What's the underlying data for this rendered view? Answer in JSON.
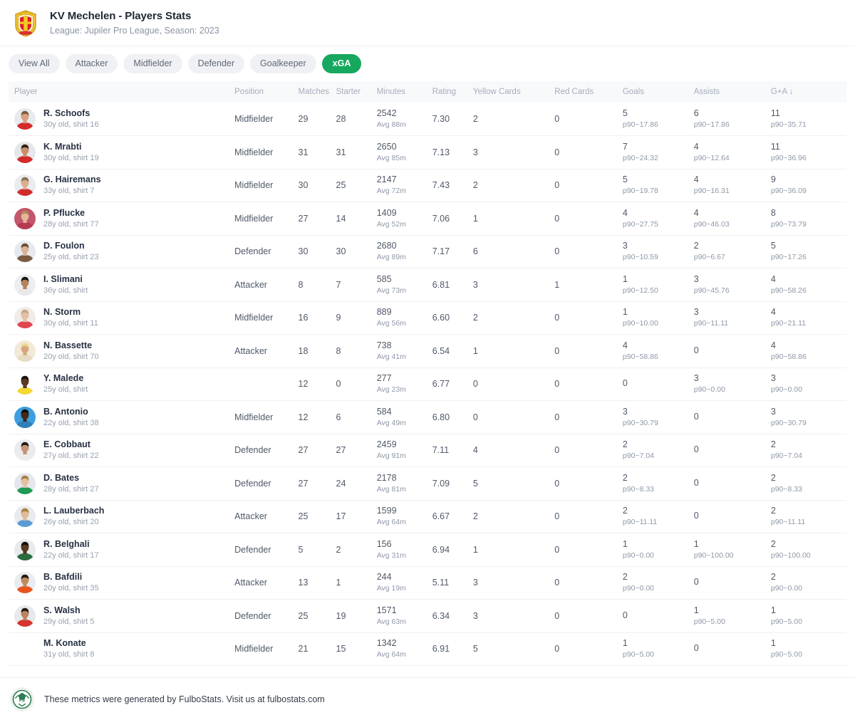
{
  "header": {
    "crest_icon": "kv-mechelen-crest",
    "title": "KV Mechelen - Players Stats",
    "subtitle": "League: Jupiler Pro League, Season: 2023"
  },
  "filters": {
    "items": [
      {
        "label": "View All",
        "active": false
      },
      {
        "label": "Attacker",
        "active": false
      },
      {
        "label": "Midfielder",
        "active": false
      },
      {
        "label": "Defender",
        "active": false
      },
      {
        "label": "Goalkeeper",
        "active": false
      },
      {
        "label": "xGA",
        "active": true
      }
    ],
    "active_color": "#17a85f",
    "inactive_color": "#f0f1f4"
  },
  "table": {
    "columns": [
      {
        "key": "player",
        "label": "Player"
      },
      {
        "key": "position",
        "label": "Position"
      },
      {
        "key": "matches",
        "label": "Matches"
      },
      {
        "key": "starter",
        "label": "Starter"
      },
      {
        "key": "minutes",
        "label": "Minutes"
      },
      {
        "key": "rating",
        "label": "Rating"
      },
      {
        "key": "yellow_cards",
        "label": "Yellow Cards"
      },
      {
        "key": "red_cards",
        "label": "Red Cards"
      },
      {
        "key": "goals",
        "label": "Goals"
      },
      {
        "key": "assists",
        "label": "Assists"
      },
      {
        "key": "ga",
        "label": "G+A ↓"
      }
    ],
    "sort": {
      "column": "G+A",
      "direction": "desc",
      "indicator": "↓"
    },
    "rows": [
      {
        "name": "R. Schoofs",
        "meta": "30y old, shirt 16",
        "avatar": "photo",
        "avatar_bg": "#e8eaee",
        "kit": "#d32b2b",
        "skin": "#d9a182",
        "hair": "#7d5b3c",
        "position": "Midfielder",
        "matches": "29",
        "starter": "28",
        "minutes": "2542",
        "minutes_sub": "Avg 88m",
        "rating": "7.30",
        "yellow_cards": "2",
        "red_cards": "0",
        "goals": "5",
        "goals_sub": "p90~17.86",
        "assists": "6",
        "assists_sub": "p90~17.86",
        "ga": "11",
        "ga_sub": "p90~35.71"
      },
      {
        "name": "K. Mrabti",
        "meta": "30y old, shirt 19",
        "avatar": "photo",
        "avatar_bg": "#e5e7eb",
        "kit": "#d32b2b",
        "skin": "#c98f6d",
        "hair": "#2e2218",
        "position": "Midfielder",
        "matches": "31",
        "starter": "31",
        "minutes": "2650",
        "minutes_sub": "Avg 85m",
        "rating": "7.13",
        "yellow_cards": "3",
        "red_cards": "0",
        "goals": "7",
        "goals_sub": "p90~24.32",
        "assists": "4",
        "assists_sub": "p90~12.64",
        "ga": "11",
        "ga_sub": "p90~36.96"
      },
      {
        "name": "G. Hairemans",
        "meta": "33y old, shirt 7",
        "avatar": "photo",
        "avatar_bg": "#e9ebee",
        "kit": "#d32b2b",
        "skin": "#dcae90",
        "hair": "#8a7155",
        "position": "Midfielder",
        "matches": "30",
        "starter": "25",
        "minutes": "2147",
        "minutes_sub": "Avg 72m",
        "rating": "7.43",
        "yellow_cards": "2",
        "red_cards": "0",
        "goals": "5",
        "goals_sub": "p90~19.78",
        "assists": "4",
        "assists_sub": "p90~16.31",
        "ga": "9",
        "ga_sub": "p90~36.09"
      },
      {
        "name": "P. Pflucke",
        "meta": "28y old, shirt 77",
        "avatar": "photo",
        "avatar_bg": "#c3566b",
        "kit": "#b43a52",
        "skin": "#e2b896",
        "hair": "#b08b5d",
        "position": "Midfielder",
        "matches": "27",
        "starter": "14",
        "minutes": "1409",
        "minutes_sub": "Avg 52m",
        "rating": "7.06",
        "yellow_cards": "1",
        "red_cards": "0",
        "goals": "4",
        "goals_sub": "p90~27.75",
        "assists": "4",
        "assists_sub": "p90~46.03",
        "ga": "8",
        "ga_sub": "p90~73.79"
      },
      {
        "name": "D. Foulon",
        "meta": "25y old, shirt 23",
        "avatar": "photo",
        "avatar_bg": "#e6eaf0",
        "kit": "#7a5a42",
        "skin": "#dcb294",
        "hair": "#6b4a30",
        "position": "Defender",
        "matches": "30",
        "starter": "30",
        "minutes": "2680",
        "minutes_sub": "Avg 89m",
        "rating": "7.17",
        "yellow_cards": "6",
        "red_cards": "0",
        "goals": "3",
        "goals_sub": "p90~10.59",
        "assists": "2",
        "assists_sub": "p90~6.67",
        "ga": "5",
        "ga_sub": "p90~17.26"
      },
      {
        "name": "I. Slimani",
        "meta": "36y old, shirt",
        "avatar": "photo",
        "avatar_bg": "#eceef1",
        "kit": "#e8e8e8",
        "skin": "#b5825c",
        "hair": "#1d150f",
        "position": "Attacker",
        "matches": "8",
        "starter": "7",
        "minutes": "585",
        "minutes_sub": "Avg 73m",
        "rating": "6.81",
        "yellow_cards": "3",
        "red_cards": "1",
        "goals": "1",
        "goals_sub": "p90~12.50",
        "assists": "3",
        "assists_sub": "p90~45.76",
        "ga": "4",
        "ga_sub": "p90~58.26"
      },
      {
        "name": "N. Storm",
        "meta": "30y old, shirt 11",
        "avatar": "photo",
        "avatar_bg": "#f0ecea",
        "kit": "#e0464f",
        "skin": "#e5c0a4",
        "hair": "#c8a77e",
        "position": "Midfielder",
        "matches": "16",
        "starter": "9",
        "minutes": "889",
        "minutes_sub": "Avg 56m",
        "rating": "6.60",
        "yellow_cards": "2",
        "red_cards": "0",
        "goals": "1",
        "goals_sub": "p90~10.00",
        "assists": "3",
        "assists_sub": "p90~11.11",
        "ga": "4",
        "ga_sub": "p90~21.11"
      },
      {
        "name": "N. Bassette",
        "meta": "20y old, shirt 70",
        "avatar": "photo",
        "avatar_bg": "#f3e9d8",
        "kit": "#e8dcc4",
        "skin": "#d8a77e",
        "hair": "#e8d98a",
        "position": "Attacker",
        "matches": "18",
        "starter": "8",
        "minutes": "738",
        "minutes_sub": "Avg 41m",
        "rating": "6.54",
        "yellow_cards": "1",
        "red_cards": "0",
        "goals": "4",
        "goals_sub": "p90~58.86",
        "assists": "0",
        "assists_sub": "",
        "ga": "4",
        "ga_sub": "p90~58.86"
      },
      {
        "name": "Y. Malede",
        "meta": "25y old, shirt",
        "avatar": "photo",
        "avatar_bg": "#ffffff",
        "kit": "#f4d933",
        "skin": "#5a3a24",
        "hair": "#1a120c",
        "position": "",
        "matches": "12",
        "starter": "0",
        "minutes": "277",
        "minutes_sub": "Avg 23m",
        "rating": "6.77",
        "yellow_cards": "0",
        "red_cards": "0",
        "goals": "0",
        "goals_sub": "",
        "assists": "3",
        "assists_sub": "p90~0.00",
        "ga": "3",
        "ga_sub": "p90~0.00"
      },
      {
        "name": "B. Antonio",
        "meta": "22y old, shirt 38",
        "avatar": "photo",
        "avatar_bg": "#3e9ede",
        "kit": "#2f7fb8",
        "skin": "#43291c",
        "hair": "#130d08",
        "position": "Midfielder",
        "matches": "12",
        "starter": "6",
        "minutes": "584",
        "minutes_sub": "Avg 49m",
        "rating": "6.80",
        "yellow_cards": "0",
        "red_cards": "0",
        "goals": "3",
        "goals_sub": "p90~30.79",
        "assists": "0",
        "assists_sub": "",
        "ga": "3",
        "ga_sub": "p90~30.79"
      },
      {
        "name": "E. Cobbaut",
        "meta": "27y old, shirt 22",
        "avatar": "photo",
        "avatar_bg": "#e9ebef",
        "kit": "#ededed",
        "skin": "#c49474",
        "hair": "#221a12",
        "position": "Defender",
        "matches": "27",
        "starter": "27",
        "minutes": "2459",
        "minutes_sub": "Avg 91m",
        "rating": "7.11",
        "yellow_cards": "4",
        "red_cards": "0",
        "goals": "2",
        "goals_sub": "p90~7.04",
        "assists": "0",
        "assists_sub": "",
        "ga": "2",
        "ga_sub": "p90~7.04"
      },
      {
        "name": "D. Bates",
        "meta": "28y old, shirt 27",
        "avatar": "photo",
        "avatar_bg": "#e4e7ec",
        "kit": "#1f9a55",
        "skin": "#e5c0a0",
        "hair": "#a97c45",
        "position": "Defender",
        "matches": "27",
        "starter": "24",
        "minutes": "2178",
        "minutes_sub": "Avg 81m",
        "rating": "7.09",
        "yellow_cards": "5",
        "red_cards": "0",
        "goals": "2",
        "goals_sub": "p90~8.33",
        "assists": "0",
        "assists_sub": "",
        "ga": "2",
        "ga_sub": "p90~8.33"
      },
      {
        "name": "L. Lauberbach",
        "meta": "26y old, shirt 20",
        "avatar": "photo",
        "avatar_bg": "#e8eaee",
        "kit": "#5b9bd5",
        "skin": "#e0bb98",
        "hair": "#a8803f",
        "position": "Attacker",
        "matches": "25",
        "starter": "17",
        "minutes": "1599",
        "minutes_sub": "Avg 64m",
        "rating": "6.67",
        "yellow_cards": "2",
        "red_cards": "0",
        "goals": "2",
        "goals_sub": "p90~11.11",
        "assists": "0",
        "assists_sub": "",
        "ga": "2",
        "ga_sub": "p90~11.11"
      },
      {
        "name": "R. Belghali",
        "meta": "22y old, shirt 17",
        "avatar": "photo",
        "avatar_bg": "#e8eaee",
        "kit": "#2a6b3f",
        "skin": "#59381f",
        "hair": "#120c07",
        "position": "Defender",
        "matches": "5",
        "starter": "2",
        "minutes": "156",
        "minutes_sub": "Avg 31m",
        "rating": "6.94",
        "yellow_cards": "1",
        "red_cards": "0",
        "goals": "1",
        "goals_sub": "p90~0.00",
        "assists": "1",
        "assists_sub": "p90~100.00",
        "ga": "2",
        "ga_sub": "p90~100.00"
      },
      {
        "name": "B. Bafdili",
        "meta": "20y old, shirt 35",
        "avatar": "photo",
        "avatar_bg": "#e9ebef",
        "kit": "#e8541f",
        "skin": "#c08a5e",
        "hair": "#241810",
        "position": "Attacker",
        "matches": "13",
        "starter": "1",
        "minutes": "244",
        "minutes_sub": "Avg 19m",
        "rating": "5.11",
        "yellow_cards": "3",
        "red_cards": "0",
        "goals": "2",
        "goals_sub": "p90~0.00",
        "assists": "0",
        "assists_sub": "",
        "ga": "2",
        "ga_sub": "p90~0.00"
      },
      {
        "name": "S. Walsh",
        "meta": "29y old, shirt 5",
        "avatar": "photo",
        "avatar_bg": "#e7e9ed",
        "kit": "#d6342f",
        "skin": "#b98460",
        "hair": "#251a11",
        "position": "Defender",
        "matches": "25",
        "starter": "19",
        "minutes": "1571",
        "minutes_sub": "Avg 63m",
        "rating": "6.34",
        "yellow_cards": "3",
        "red_cards": "0",
        "goals": "0",
        "goals_sub": "",
        "assists": "1",
        "assists_sub": "p90~5.00",
        "ga": "1",
        "ga_sub": "p90~5.00"
      },
      {
        "name": "M. Konate",
        "meta": "31y old, shirt 8",
        "avatar": "none",
        "avatar_bg": "#ffffff",
        "kit": "#ffffff",
        "skin": "#ffffff",
        "hair": "#ffffff",
        "position": "Midfielder",
        "matches": "21",
        "starter": "15",
        "minutes": "1342",
        "minutes_sub": "Avg 64m",
        "rating": "6.91",
        "yellow_cards": "5",
        "red_cards": "0",
        "goals": "1",
        "goals_sub": "p90~5.00",
        "assists": "0",
        "assists_sub": "",
        "ga": "1",
        "ga_sub": "p90~5.00"
      }
    ]
  },
  "footer": {
    "logo_icon": "fulbostats-ball-logo",
    "text": "These metrics were generated by FulboStats. Visit us at fulbostats.com"
  }
}
